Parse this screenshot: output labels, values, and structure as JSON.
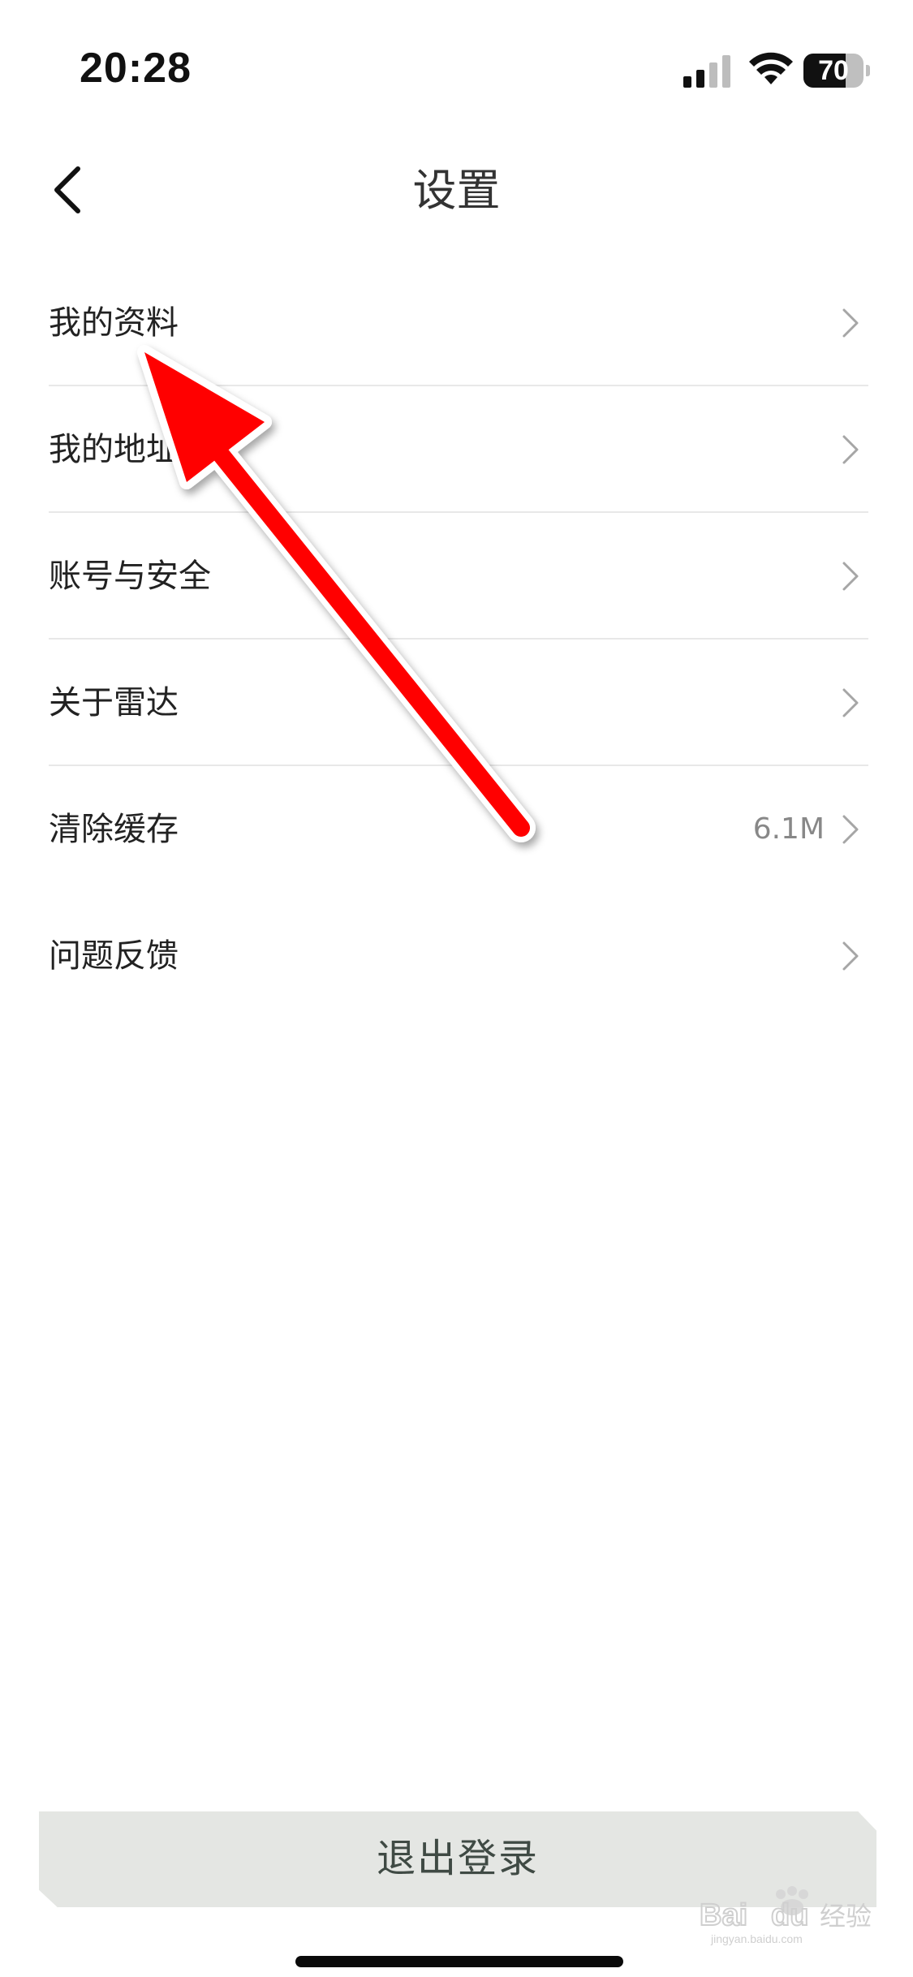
{
  "status_bar": {
    "time": "20:28",
    "battery_level": "70",
    "battery_fraction": 0.7
  },
  "nav": {
    "title": "设置",
    "back_icon": "chevron-left-icon"
  },
  "settings_items": [
    {
      "label": "我的资料",
      "value": ""
    },
    {
      "label": "我的地址",
      "value": ""
    },
    {
      "label": "账号与安全",
      "value": ""
    },
    {
      "label": "关于雷达",
      "value": ""
    },
    {
      "label": "清除缓存",
      "value": "6.1M"
    },
    {
      "label": "问题反馈",
      "value": ""
    }
  ],
  "logout": {
    "label": "退出登录"
  },
  "annotation": {
    "color": "#ff0000",
    "target": "我的资料"
  },
  "watermark": {
    "text": "Baidu经验",
    "subtext": "jingyan.baidu.com"
  }
}
